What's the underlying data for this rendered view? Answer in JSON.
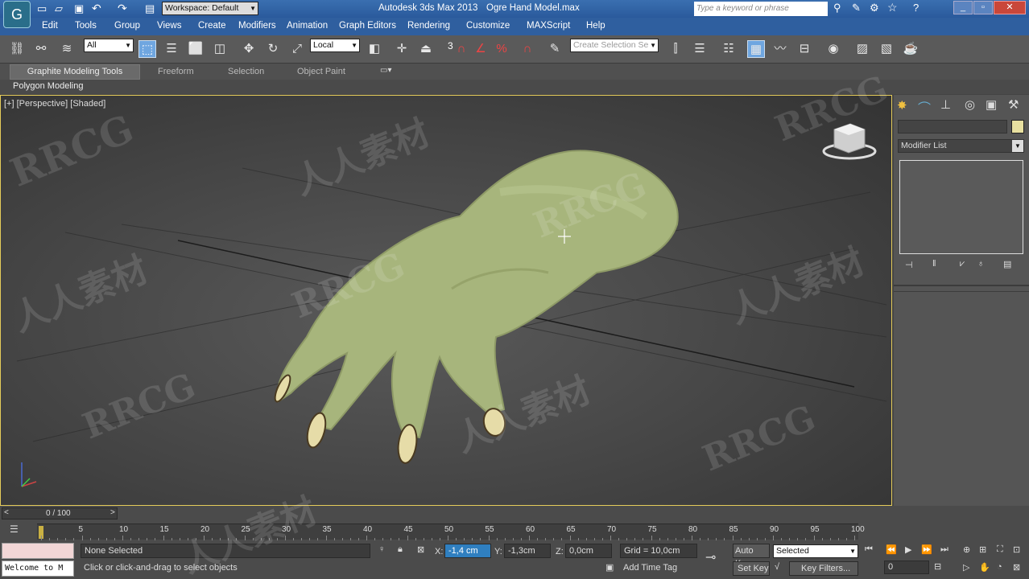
{
  "title_bar": {
    "workspace_label": "Workspace: Default",
    "app_title": "Autodesk 3ds Max  2013",
    "file_name": "Ogre Hand Model.max",
    "search_placeholder": "Type a keyword or phrase"
  },
  "menu": [
    "Edit",
    "Tools",
    "Group",
    "Views",
    "Create",
    "Modifiers",
    "Animation",
    "Graph Editors",
    "Rendering",
    "Customize",
    "MAXScript",
    "Help"
  ],
  "toolbar": {
    "selection_filter": "All",
    "ref_coord": "Local",
    "create_selection_set": "Create Selection Se",
    "snap_value": "3"
  },
  "ribbon": {
    "tabs": [
      "Graphite Modeling Tools",
      "Freeform",
      "Selection",
      "Object Paint"
    ],
    "subpanel": "Polygon Modeling"
  },
  "viewport": {
    "label_plus": "[+]",
    "label_view": "[Perspective]",
    "label_shading": "[Shaded]"
  },
  "command_panel": {
    "modifier_list": "Modifier List",
    "swatch_color": "#e8e0a0"
  },
  "timeline": {
    "frame_counter": "0 / 100",
    "ticks": [
      "5",
      "10",
      "15",
      "20",
      "25",
      "30",
      "35",
      "40",
      "45",
      "50",
      "55",
      "60",
      "65",
      "70",
      "75",
      "80",
      "85",
      "90",
      "95",
      "100"
    ]
  },
  "status": {
    "listener": "Welcome to M",
    "selection": "None Selected",
    "prompt": "Click or click-and-drag to select objects",
    "x_label": "X:",
    "x_value": "-1,4 cm",
    "y_label": "Y:",
    "y_value": "-1,3cm",
    "z_label": "Z:",
    "z_value": "0,0cm",
    "grid": "Grid = 10,0cm",
    "add_time_tag": "Add Time Tag",
    "auto_key": "Auto Key",
    "set_key": "Set Key",
    "key_mode": "Selected",
    "key_filters": "Key Filters...",
    "frame_field": "0"
  },
  "watermarks": [
    "RRCG",
    "人人素材",
    "RRCG",
    "人人素材",
    "RRCG",
    "人人素材",
    "RRCG",
    "人人素材",
    "RRCG",
    "RRCG",
    "人人素材"
  ],
  "colors": {
    "viewport_border": "#e5cc5a",
    "menu_bg": "#2f5f9f",
    "hand_skin": "#a8b57a"
  }
}
